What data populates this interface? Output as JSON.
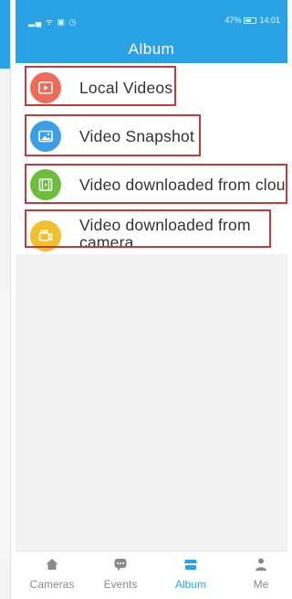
{
  "status_bar": {
    "left_icons": "▂▄ ᯤ ▣ ◷",
    "battery_percent": "47%",
    "time": "14:01"
  },
  "header": {
    "title": "Album"
  },
  "album_items": [
    {
      "label": "Local Videos",
      "icon": "play-video-icon",
      "color": "#ef6b59"
    },
    {
      "label": "Video Snapshot",
      "icon": "image-icon",
      "color": "#3d9ee8"
    },
    {
      "label": "Video downloaded from cloud",
      "icon": "film-strip-icon",
      "color": "#6cbf3b"
    },
    {
      "label": "Video downloaded from camera.",
      "icon": "camera-icon",
      "color": "#f2c02e"
    }
  ],
  "tabs": [
    {
      "label": "Cameras",
      "icon": "home-icon",
      "active": false
    },
    {
      "label": "Events",
      "icon": "chat-icon",
      "active": false
    },
    {
      "label": "Album",
      "icon": "album-icon",
      "active": true
    },
    {
      "label": "Me",
      "icon": "person-icon",
      "active": false
    }
  ],
  "colors": {
    "accent": "#2aa3e6",
    "highlight_outline": "#c63a3a",
    "inactive_tab": "#8a8a8a"
  }
}
